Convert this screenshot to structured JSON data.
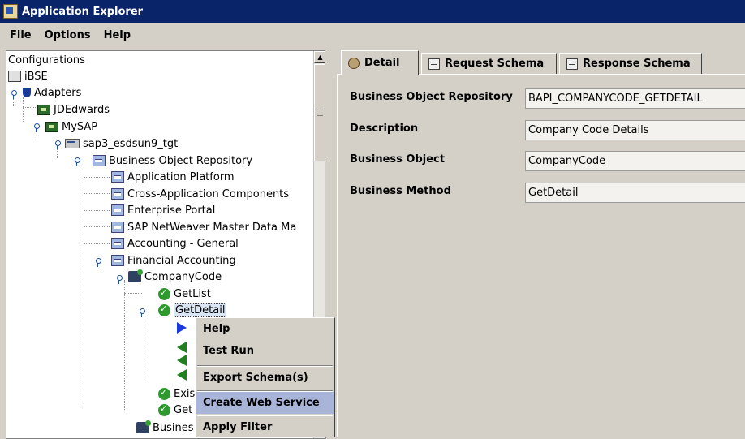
{
  "window": {
    "title": "Application Explorer"
  },
  "menubar": {
    "file": "File",
    "options": "Options",
    "help": "Help"
  },
  "tree": {
    "root": "Configurations",
    "ibse": "iBSE",
    "adapters": "Adapters",
    "jdedwards": "JDEdwards",
    "mysap": "MySAP",
    "server": "sap3_esdsun9_tgt",
    "bor": "Business Object Repository",
    "app_platform": "Application Platform",
    "cross_app": "Cross-Application Components",
    "enterprise_portal": "Enterprise Portal",
    "netweaver": "SAP NetWeaver Master Data Ma",
    "accounting": "Accounting - General",
    "financial": "Financial Accounting",
    "company_code": "CompanyCode",
    "getlist": "GetList",
    "getdetail": "GetDetail",
    "exis": "Exis",
    "get": "Get",
    "busines": "Busines"
  },
  "context_menu": {
    "help": "Help",
    "test_run": "Test Run",
    "export_schema": "Export Schema(s)",
    "create_ws": "Create Web Service",
    "apply_filter": "Apply Filter"
  },
  "tabs": {
    "detail": "Detail",
    "request": "Request Schema",
    "response": "Response Schema"
  },
  "details": {
    "bor_label": "Business Object Repository",
    "bor_value": "BAPI_COMPANYCODE_GETDETAIL",
    "desc_label": "Description",
    "desc_value": "Company Code Details",
    "bo_label": "Business Object",
    "bo_value": "CompanyCode",
    "bm_label": "Business Method",
    "bm_value": "GetDetail"
  }
}
